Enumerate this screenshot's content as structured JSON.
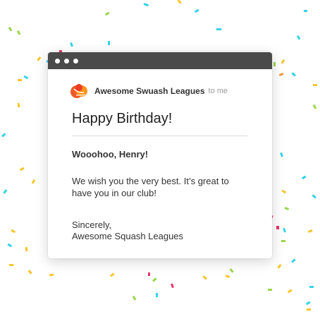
{
  "email": {
    "sender_name": "Awesome Swuash Leagues",
    "recipient_label": "to me",
    "subject": "Happy Birthday!",
    "greeting": "Wooohoo, Henry!",
    "body": "We wish you the very best. It’s great to have you in our club!",
    "closing": "Sincerely,",
    "signature": "Awesome Squash Leagues"
  },
  "colors": {
    "titlebar": "#4a4a4a",
    "confetti": [
      "#35d3e8",
      "#f9c52d",
      "#f39a3c",
      "#9ad64b",
      "#e8356a"
    ]
  },
  "icons": {
    "window_controls": [
      "window-dot-icon",
      "window-dot-icon",
      "window-dot-icon"
    ],
    "sender_logo": "squash-ball-logo-icon"
  }
}
